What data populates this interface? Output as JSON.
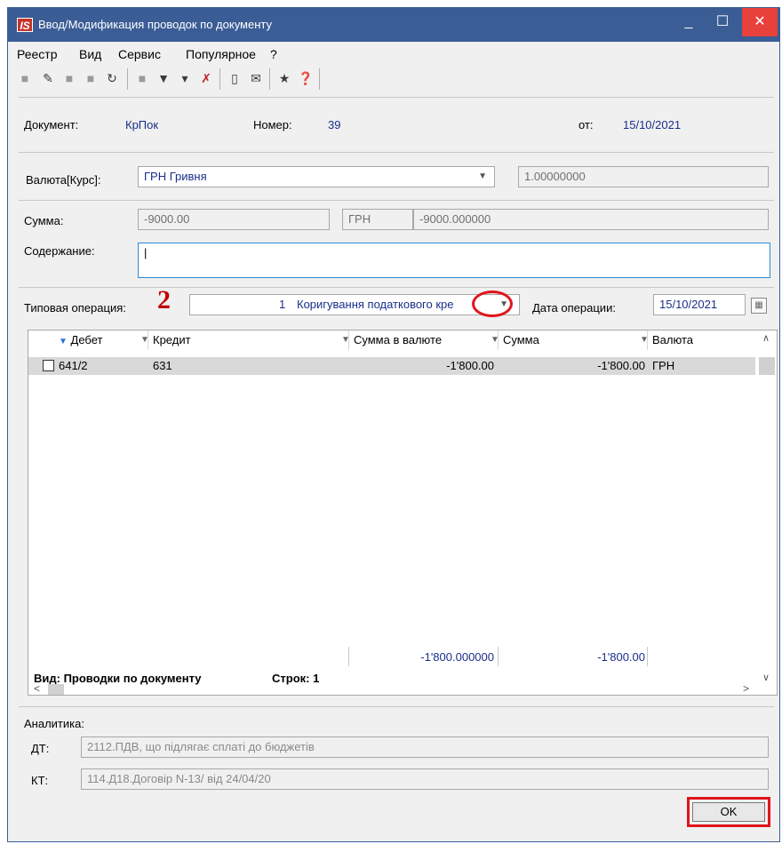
{
  "window": {
    "title": "Ввод/Модификация проводок по документу",
    "logo": "IS",
    "controls": {
      "minimize": "_",
      "maximize": "☐",
      "close": "✕"
    }
  },
  "menu": [
    "Реестр",
    "Вид",
    "Сервис",
    "Популярное",
    "?"
  ],
  "toolbar_icons": [
    "create-icon",
    "edit-icon",
    "copy-icon",
    "delete-icon",
    "refresh-icon",
    "view-icon",
    "filter-icon",
    "filter-add-icon",
    "filter-clear-icon",
    "document-icon",
    "mail-icon",
    "star-icon",
    "help-icon"
  ],
  "header": {
    "doc_label": "Документ:",
    "doc_value": "КрПок",
    "num_label": "Номер:",
    "num_value": "39",
    "date_label": "от:",
    "date_value": "15/10/2021"
  },
  "currency": {
    "label": "Валюта[Курс]:",
    "value": "ГРН Гривня",
    "rate": "1.00000000"
  },
  "sum": {
    "label": "Сумма:",
    "value": "-9000.00",
    "currency": "ГРН",
    "amount": "-9000.000000"
  },
  "content": {
    "label": "Содержание:",
    "value": "|"
  },
  "operation": {
    "label": "Типовая операция:",
    "annotation": "2",
    "number": "1",
    "name": "Коригування податкового кре",
    "date_label": "Дата операции:",
    "date_value": "15/10/2021"
  },
  "grid": {
    "columns": [
      "Дебет",
      "Кредит",
      "Сумма в валюте",
      "Сумма",
      "Валюта"
    ],
    "rows": [
      {
        "debit": "641/2",
        "credit": "631",
        "sum_currency": "-1'800.00",
        "sum": "-1'800.00",
        "currency": "ГРН"
      }
    ],
    "totals": {
      "sum_currency": "-1'800.000000",
      "sum": "-1'800.00"
    },
    "footer_view": "Вид: Проводки по документу",
    "footer_rows": "Строк: 1"
  },
  "analytics": {
    "label": "Аналитика:",
    "dt_label": "ДТ:",
    "dt_value": "2112.ПДВ, що підлягає сплаті до бюджетів",
    "kt_label": "КТ:",
    "kt_value": "114.Д18.Договір N-13/ від 24/04/20"
  },
  "buttons": {
    "ok": "OK"
  },
  "colors": {
    "titlebar": "#3b5d96",
    "highlight": "#e0141c",
    "value_text": "#1a2f8a"
  }
}
